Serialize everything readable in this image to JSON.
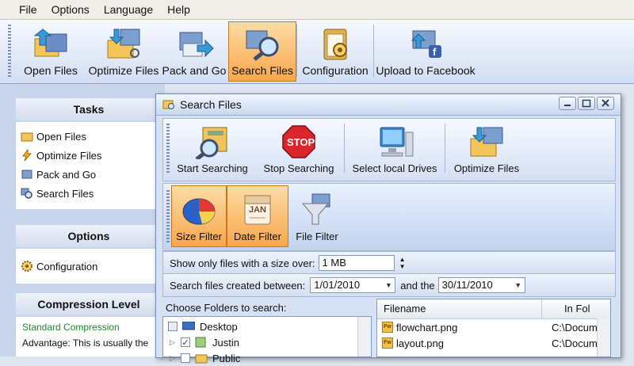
{
  "menu": [
    "File",
    "Options",
    "Language",
    "Help"
  ],
  "toolbar": {
    "buttons": [
      {
        "label": "Open Files",
        "icon": "open-files-icon"
      },
      {
        "label": "Optimize Files",
        "icon": "optimize-files-icon"
      },
      {
        "label": "Pack and Go",
        "icon": "pack-and-go-icon"
      },
      {
        "label": "Search Files",
        "icon": "search-files-icon",
        "active": true
      },
      {
        "label": "Configuration",
        "icon": "configuration-icon"
      },
      {
        "label": "Upload to Facebook",
        "icon": "facebook-upload-icon"
      }
    ]
  },
  "sidebar": {
    "tasks": {
      "title": "Tasks",
      "items": [
        {
          "label": "Open Files",
          "icon": "folder-open-icon"
        },
        {
          "label": "Optimize Files",
          "icon": "lightning-icon"
        },
        {
          "label": "Pack and Go",
          "icon": "pack-icon"
        },
        {
          "label": "Search Files",
          "icon": "search-icon"
        }
      ]
    },
    "options": {
      "title": "Options",
      "items": [
        {
          "label": "Configuration",
          "icon": "gear-icon"
        }
      ]
    },
    "compression": {
      "title": "Compression Level",
      "selected": "Standard Compression",
      "description": "Advantage: This is usually the"
    }
  },
  "dialog": {
    "title": "Search Files",
    "toolbar1": [
      {
        "label": "Start Searching",
        "icon": "start-search-icon"
      },
      {
        "label": "Stop Searching",
        "icon": "stop-sign-icon",
        "stop_text": "STOP"
      },
      {
        "label": "Select local Drives",
        "icon": "computer-icon"
      },
      {
        "label": "Optimize Files",
        "icon": "optimize-files-icon"
      }
    ],
    "toolbar2": [
      {
        "label": "Size Filter",
        "icon": "pie-chart-icon",
        "active": true
      },
      {
        "label": "Date Filter",
        "icon": "calendar-icon",
        "active": true,
        "calendar_text": "JAN"
      },
      {
        "label": "File Filter",
        "icon": "funnel-icon"
      }
    ],
    "size_filter": {
      "label": "Show only files with a size over:",
      "value": "1 MB"
    },
    "date_filter": {
      "label": "Search files created between:",
      "from": "1/01/2010",
      "and_label": "and the",
      "to": "30/11/2010"
    },
    "folders_label": "Choose Folders to search:",
    "tree": [
      {
        "label": "Desktop",
        "checked": false
      },
      {
        "label": "Justin",
        "checked": true
      },
      {
        "label": "Public",
        "checked": false
      }
    ],
    "file_list": {
      "columns": [
        "Filename",
        "In Fol"
      ],
      "rows": [
        {
          "name": "flowchart.png",
          "folder": "C:\\Docume"
        },
        {
          "name": "layout.png",
          "folder": "C:\\Docume"
        }
      ]
    }
  },
  "colors": {
    "active_bg": "#f8a64a",
    "accent_blue": "#3b5fa8"
  }
}
